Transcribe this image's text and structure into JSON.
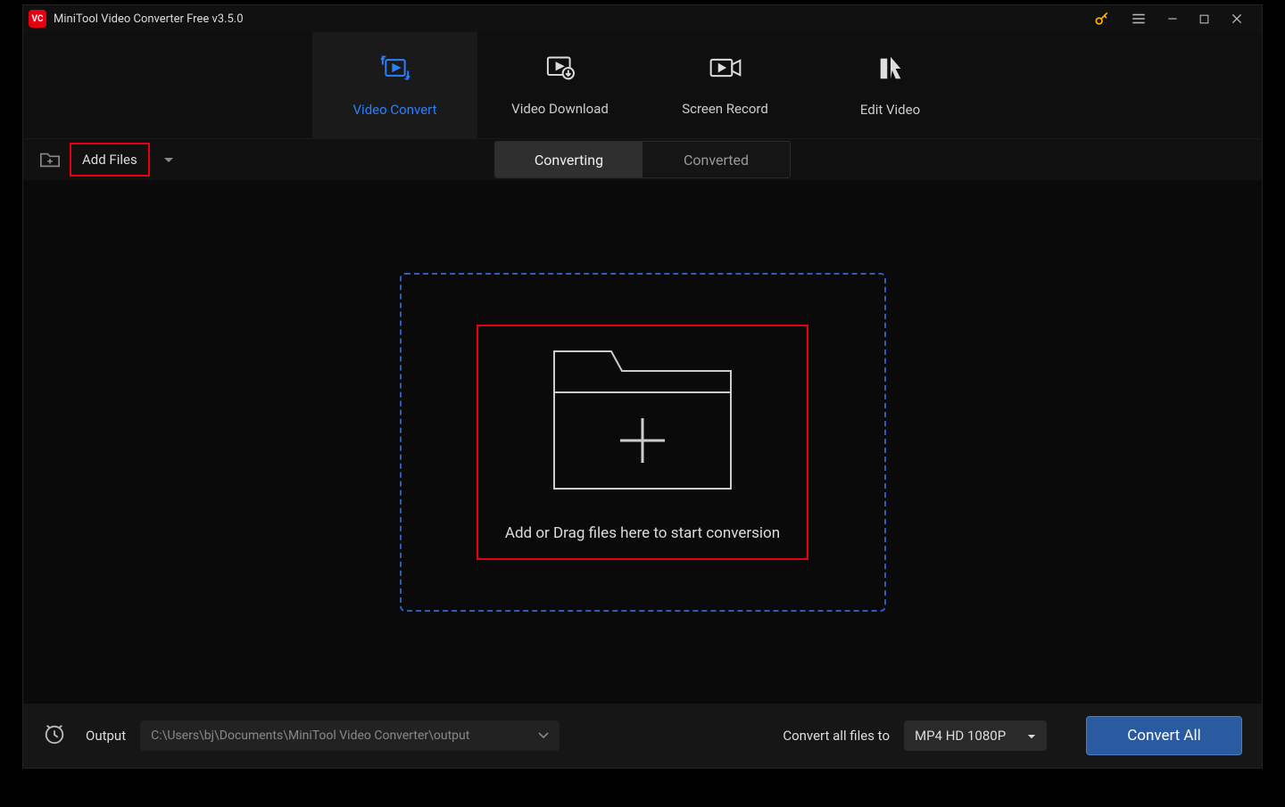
{
  "titlebar": {
    "title": "MiniTool Video Converter Free v3.5.0"
  },
  "nav": {
    "tabs": [
      {
        "label": "Video Convert"
      },
      {
        "label": "Video Download"
      },
      {
        "label": "Screen Record"
      },
      {
        "label": "Edit Video"
      }
    ]
  },
  "toolbar": {
    "add_files": "Add Files"
  },
  "subtabs": {
    "converting": "Converting",
    "converted": "Converted"
  },
  "dropzone": {
    "text": "Add or Drag files here to start conversion"
  },
  "bottom": {
    "output_label": "Output",
    "output_path": "C:\\Users\\bj\\Documents\\MiniTool Video Converter\\output",
    "convert_label": "Convert all files to",
    "format": "MP4 HD 1080P",
    "convert_all": "Convert All"
  }
}
